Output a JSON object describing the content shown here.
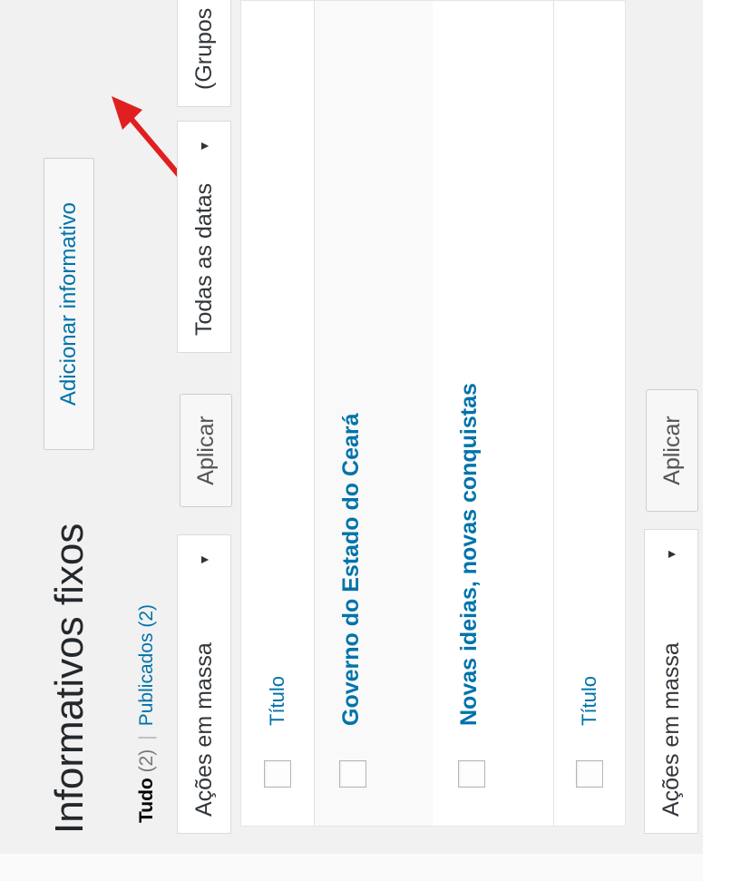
{
  "page_title": "Informativos fixos",
  "add_new_label": "Adicionar informativo",
  "views": {
    "all_label": "Tudo",
    "all_count": "(2)",
    "separator": "|",
    "published_label": "Publicados",
    "published_count": "(2)"
  },
  "filters": {
    "bulk_actions_top": "Ações em massa",
    "apply_top": "Aplicar",
    "dates": "Todas as datas",
    "groups": "(Grupos"
  },
  "table": {
    "header_title": "Título",
    "footer_title": "Título",
    "rows": [
      {
        "title": "Governo do Estado do Ceará"
      },
      {
        "title": "Novas ideias, novas conquistas"
      }
    ]
  },
  "bottom": {
    "bulk_actions": "Ações em massa",
    "apply": "Aplicar"
  },
  "colors": {
    "link": "#0073aa",
    "background": "#f1f1f1",
    "annotation_arrow": "#e02020"
  },
  "icons": [
    "caret-down-icon",
    "annotation-arrow-icon"
  ]
}
